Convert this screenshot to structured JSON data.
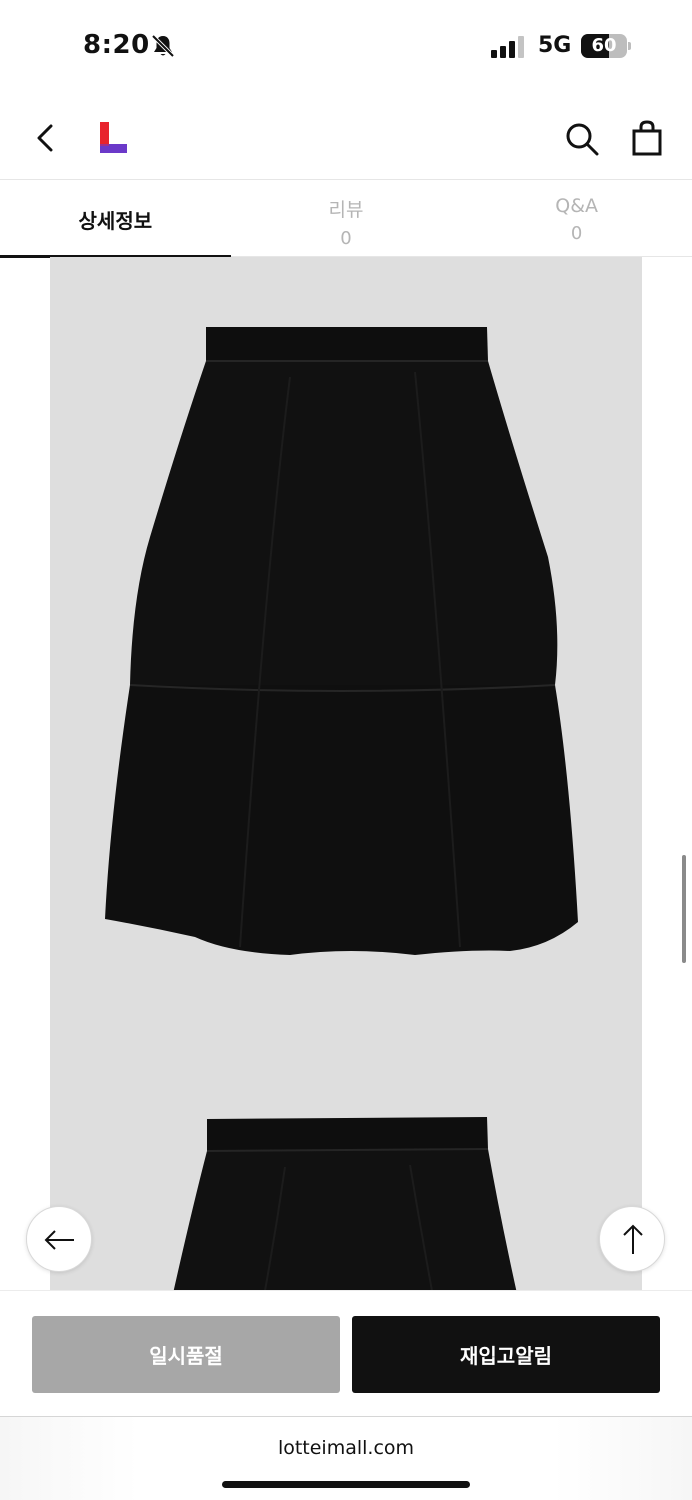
{
  "status_bar": {
    "time": "8:20",
    "network": "5G",
    "battery": "60",
    "battery_level": 0.6
  },
  "header": {
    "logo_colors": {
      "red": "#e8232d",
      "purple": "#6b39c9"
    },
    "icons": [
      "back-arrow-icon",
      "search-icon",
      "shopping-bag-icon"
    ]
  },
  "tabs": [
    {
      "label": "상세정보",
      "count": ""
    },
    {
      "label": "리뷰",
      "count": "0"
    },
    {
      "label": "Q&A",
      "count": "0"
    }
  ],
  "floating_buttons": {
    "left_icon": "arrow-left-icon",
    "right_icon": "arrow-up-icon"
  },
  "actions": {
    "soldout_label": "일시품절",
    "restock_label": "재입고알림"
  },
  "browser": {
    "url": "lotteimall.com"
  }
}
